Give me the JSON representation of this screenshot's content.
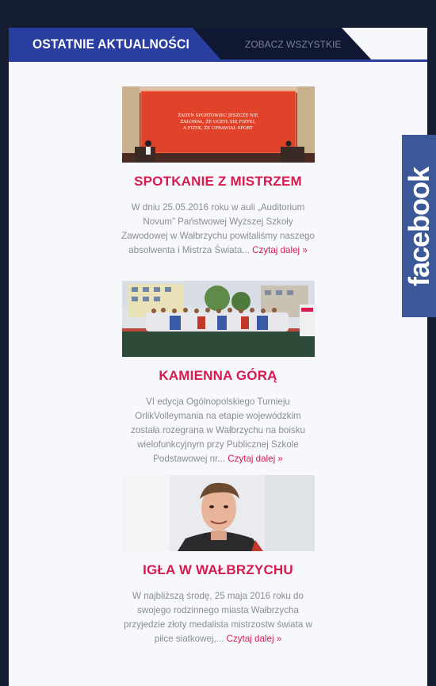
{
  "tabs": {
    "active": "OSTATNIE AKTUALNOŚCI",
    "inactive": "ZOBACZ WSZYSTKIE"
  },
  "news": [
    {
      "image_text": "ŻADEN SPORTOWIEC JESZCZE NIE ŻAŁOWAŁ, ŻE UCZYŁ SIĘ FIZYKI, A FIZYK, ŻE UPRAWIAŁ SPORT",
      "title": "SPOTKANIE Z MISTRZEM",
      "excerpt": "W dniu 25.05.2016 roku w auli „Auditorium Novum” Państwowej Wyższej Szkoły Zawodowej w Wałbrzychu powitaliśmy naszego absolwenta i Mistrza Świata...",
      "read_more": "Czytaj dalej »"
    },
    {
      "title": "KAMIENNA GÓRĄ",
      "excerpt": "VI edycja Ogólnopolskiego Turnieju OrlikVolleymania na etapie wojewódzkim została rozegrana w Wałbrzychu na boisku wielofunkcyjnym przy Publicznej Szkole Podstawowej nr...",
      "read_more": "Czytaj dalej »"
    },
    {
      "title": "IGŁA W WAŁBRZYCHU",
      "excerpt": "W najbliższą środę, 25 maja 2016 roku do swojego rodzinnego miasta Wałbrzycha przyjedzie złoty medalista mistrzostw świata w piłce siatkowej,...",
      "read_more": "Czytaj dalej »"
    }
  ],
  "facebook": {
    "label": "facebook"
  },
  "colors": {
    "accent": "#d81b4e",
    "tab": "#2a3ea0",
    "facebook": "#3b5998",
    "background": "#151d33"
  }
}
